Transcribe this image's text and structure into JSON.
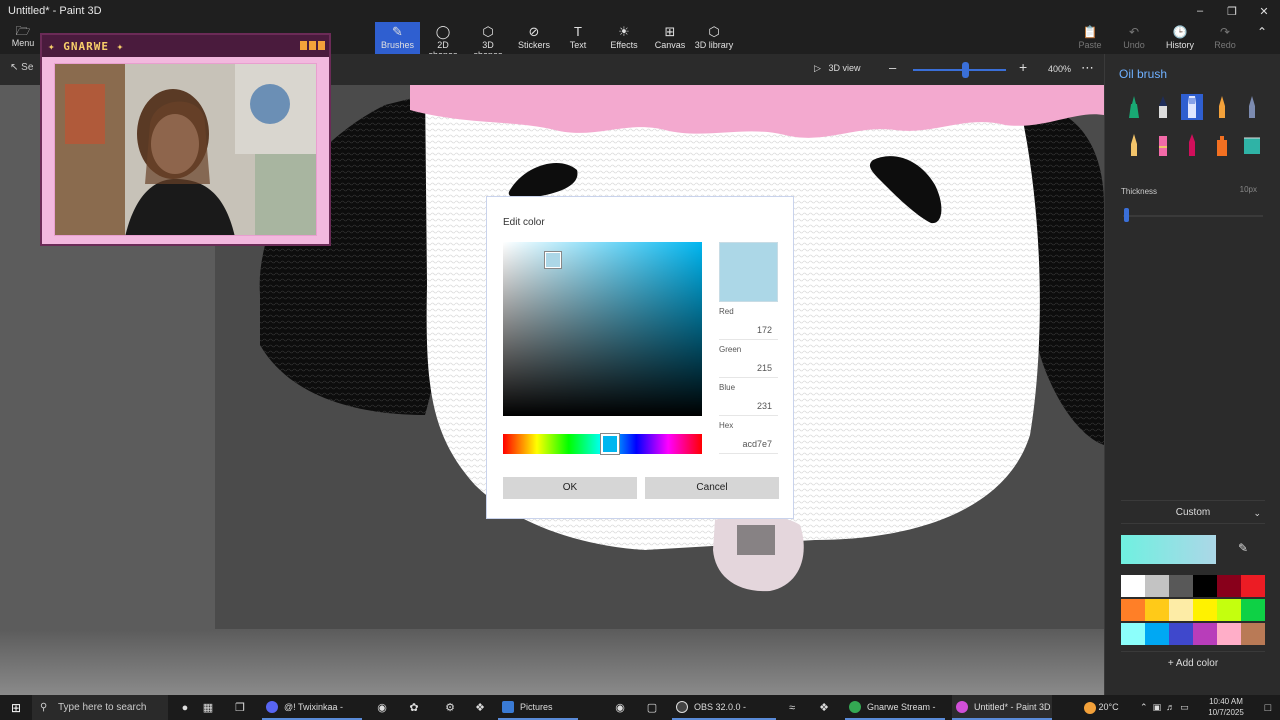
{
  "window": {
    "title": "Untitled* - Paint 3D"
  },
  "ribbon": {
    "menu_label": "Menu",
    "tools": [
      {
        "label": "Brushes",
        "icon": "brush-icon"
      },
      {
        "label": "2D shapes",
        "icon": "2d-shapes-icon"
      },
      {
        "label": "3D shapes",
        "icon": "3d-shapes-icon"
      },
      {
        "label": "Stickers",
        "icon": "stickers-icon"
      },
      {
        "label": "Text",
        "icon": "text-icon"
      },
      {
        "label": "Effects",
        "icon": "effects-icon"
      },
      {
        "label": "Canvas",
        "icon": "canvas-icon"
      },
      {
        "label": "3D library",
        "icon": "3d-library-icon"
      }
    ],
    "right_tools": {
      "paste": "Paste",
      "undo": "Undo",
      "history": "History",
      "redo": "Redo"
    }
  },
  "subbar": {
    "select_label": "Se",
    "view3d_label": "3D view",
    "zoom_label": "400%"
  },
  "webcam": {
    "name": "GNARWE"
  },
  "dialog": {
    "title": "Edit color",
    "fields": {
      "red_label": "Red",
      "red_value": "172",
      "green_label": "Green",
      "green_value": "215",
      "blue_label": "Blue",
      "blue_value": "231",
      "hex_label": "Hex",
      "hex_value": "acd7e7"
    },
    "ok_label": "OK",
    "cancel_label": "Cancel",
    "color": "#acd7e7"
  },
  "panel": {
    "title": "Oil brush",
    "thickness_label": "Thickness",
    "thickness_value": "10px",
    "thickness_fraction": 0.02,
    "custom_label": "Custom",
    "add_color_label": "Add color",
    "palette": [
      "#ffffff",
      "#c3c3c3",
      "#585858",
      "#000000",
      "#88001b",
      "#ec1c24",
      "#ff7f27",
      "#ffca18",
      "#fdeca6",
      "#fff200",
      "#c4ff0e",
      "#0ed145",
      "#8cfffb",
      "#00a8f3",
      "#3f48cc",
      "#b83dba",
      "#ffaec8",
      "#b97a56"
    ]
  },
  "taskbar": {
    "search_placeholder": "Type here to search",
    "apps": [
      {
        "label": "@! Twixinkaa - Disc...",
        "color": "#5865f2"
      },
      {
        "label": "Pictures",
        "color": "#3a7bd5"
      },
      {
        "label": "OBS 32.0.0 - Profile...",
        "color": "#444444"
      },
      {
        "label": "Gnarwe Stream - W...",
        "color": "#34a853"
      },
      {
        "label": "Untitled* - Paint 3D",
        "color": "#d14fd8"
      }
    ],
    "weather": "20°C",
    "time": "10:40 AM",
    "date": "10/7/2025"
  }
}
